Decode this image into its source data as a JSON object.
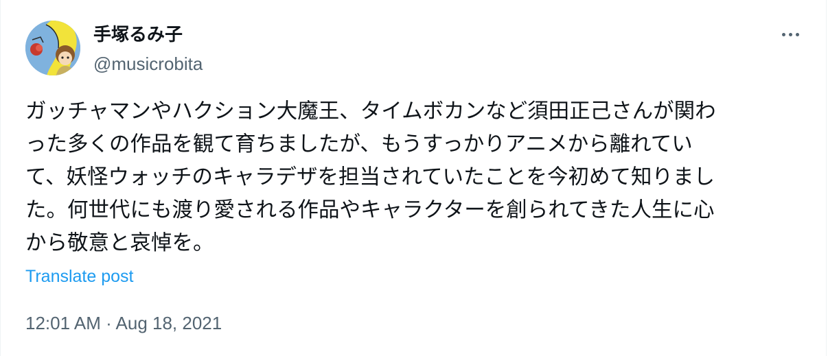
{
  "author": {
    "display_name": "手塚るみ子",
    "handle": "@musicrobita"
  },
  "post": {
    "lines": [
      "ガッチャマンやハクション大魔王、タイムボカンなど須田正己さんが関わ",
      "った多くの作品を観て育ちましたが、もうすっかりアニメから離れてい",
      "て、妖怪ウォッチのキャラデザを担当されていたことを今初めて知りまし",
      "た。何世代にも渡り愛される作品やキャラクターを創られてきた人生に心",
      "から敬意と哀悼を。"
    ],
    "translate_label": "Translate post",
    "timestamp": "12:01 AM · Aug 18, 2021"
  },
  "icons": {
    "more": "more-dots-icon"
  },
  "colors": {
    "text": "#0f1419",
    "secondary": "#536471",
    "link": "#1d9bf0"
  }
}
